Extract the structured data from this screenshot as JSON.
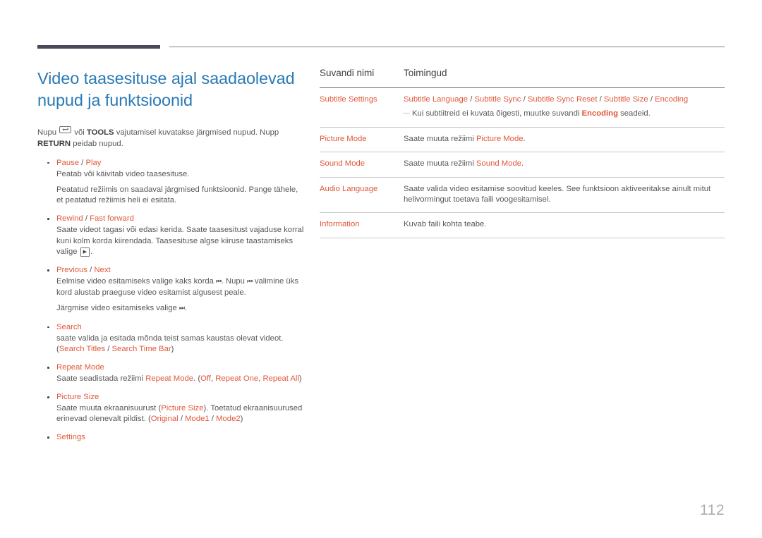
{
  "document": {
    "page_number": "112",
    "colors": {
      "heading_blue": "#2a7ab5",
      "accent_orange": "#e0583a",
      "body_gray": "#58585a",
      "rule_dark": "#4a4759",
      "note_gray": "#a9a8ac"
    }
  },
  "heading": {
    "title": "Video taasesituse ajal saadaolevad nupud ja funktsioonid"
  },
  "intro": {
    "before_key": "Nupu ",
    "key_icon": "enter-return-key-icon",
    "after_key": " või ",
    "tools_label": "TOOLS",
    "middle": " vajutamisel kuvatakse järgmised nupud. Nupp ",
    "return_label": "RETURN",
    "end": " peidab nupud."
  },
  "bullets": [
    {
      "title_parts": [
        {
          "text": "Pause",
          "style": "accent"
        },
        {
          "text": " / ",
          "style": "plain"
        },
        {
          "text": "Play",
          "style": "accent"
        }
      ],
      "paragraphs": [
        [
          {
            "text": "Peatab või käivitab video taasesituse.",
            "style": "plain"
          }
        ],
        [
          {
            "text": "Peatatud režiimis on saadaval järgmised funktsioonid. Pange tähele, et peatatud režiimis heli ei esitata.",
            "style": "plain"
          }
        ]
      ]
    },
    {
      "title_parts": [
        {
          "text": "Rewind",
          "style": "accent"
        },
        {
          "text": " / ",
          "style": "plain"
        },
        {
          "text": "Fast forward",
          "style": "accent"
        }
      ],
      "paragraphs": [
        [
          {
            "text": "Saate videot tagasi või edasi kerida. Saate taasesitust vajaduse korral kuni kolm korda kiirendada. Taasesituse algse kiiruse taastamiseks valige ",
            "style": "plain"
          },
          {
            "text": "▶",
            "style": "key"
          },
          {
            "text": ".",
            "style": "plain"
          }
        ]
      ]
    },
    {
      "title_parts": [
        {
          "text": "Previous",
          "style": "accent"
        },
        {
          "text": " / ",
          "style": "plain"
        },
        {
          "text": "Next",
          "style": "accent"
        }
      ],
      "paragraphs": [
        [
          {
            "text": "Eelmise video esitamiseks valige kaks korda ",
            "style": "plain"
          },
          {
            "text": "⏮",
            "style": "glyph"
          },
          {
            "text": ". Nupu ",
            "style": "plain"
          },
          {
            "text": "⏮",
            "style": "glyph"
          },
          {
            "text": " valimine üks kord alustab praeguse video esitamist algusest peale.",
            "style": "plain"
          }
        ],
        [
          {
            "text": "Järgmise video esitamiseks valige ",
            "style": "plain"
          },
          {
            "text": "⏭",
            "style": "glyph"
          },
          {
            "text": ".",
            "style": "plain"
          }
        ]
      ]
    },
    {
      "title_parts": [
        {
          "text": "Search",
          "style": "accent"
        }
      ],
      "paragraphs": [
        [
          {
            "text": "saate valida ja esitada mõnda teist samas kaustas olevat videot. (",
            "style": "plain"
          },
          {
            "text": "Search Titles",
            "style": "accent"
          },
          {
            "text": " / ",
            "style": "plain"
          },
          {
            "text": "Search Time Bar",
            "style": "accent"
          },
          {
            "text": ")",
            "style": "plain"
          }
        ]
      ]
    },
    {
      "title_parts": [
        {
          "text": "Repeat Mode",
          "style": "accent"
        }
      ],
      "paragraphs": [
        [
          {
            "text": "Saate seadistada režiimi ",
            "style": "plain"
          },
          {
            "text": "Repeat Mode",
            "style": "accent"
          },
          {
            "text": ". (",
            "style": "plain"
          },
          {
            "text": "Off",
            "style": "accent"
          },
          {
            "text": ", ",
            "style": "plain"
          },
          {
            "text": "Repeat One",
            "style": "accent"
          },
          {
            "text": ", ",
            "style": "plain"
          },
          {
            "text": "Repeat All",
            "style": "accent"
          },
          {
            "text": ")",
            "style": "plain"
          }
        ]
      ]
    },
    {
      "title_parts": [
        {
          "text": "Picture Size",
          "style": "accent"
        }
      ],
      "paragraphs": [
        [
          {
            "text": "Saate muuta ekraanisuurust (",
            "style": "plain"
          },
          {
            "text": "Picture Size",
            "style": "accent"
          },
          {
            "text": "). Toetatud ekraanisuurused erinevad olenevalt pildist. (",
            "style": "plain"
          },
          {
            "text": "Original",
            "style": "accent"
          },
          {
            "text": " / ",
            "style": "plain"
          },
          {
            "text": "Mode1",
            "style": "accent"
          },
          {
            "text": " / ",
            "style": "plain"
          },
          {
            "text": "Mode2",
            "style": "accent"
          },
          {
            "text": ")",
            "style": "plain"
          }
        ]
      ]
    },
    {
      "title_parts": [
        {
          "text": "Settings",
          "style": "accent"
        }
      ],
      "paragraphs": []
    }
  ],
  "table": {
    "columns": [
      "Suvandi nimi",
      "Toimingud"
    ],
    "rows": [
      {
        "name": "Subtitle Settings",
        "action_parts": [
          {
            "text": "Subtitle Language",
            "style": "accent"
          },
          {
            "text": " / ",
            "style": "plain"
          },
          {
            "text": "Subtitle Sync",
            "style": "accent"
          },
          {
            "text": " / ",
            "style": "plain"
          },
          {
            "text": "Subtitle Sync Reset",
            "style": "accent"
          },
          {
            "text": " / ",
            "style": "plain"
          },
          {
            "text": "Subtitle Size",
            "style": "accent"
          },
          {
            "text": " / ",
            "style": "plain"
          },
          {
            "text": "Encoding",
            "style": "accent"
          }
        ],
        "note_parts": [
          {
            "text": "Kui subtiitreid ei kuvata õigesti, muutke suvandi ",
            "style": "plain"
          },
          {
            "text": "Encoding",
            "style": "accent"
          },
          {
            "text": " seadeid.",
            "style": "plain"
          }
        ]
      },
      {
        "name": "Picture Mode",
        "action_parts": [
          {
            "text": "Saate muuta režiimi ",
            "style": "plain"
          },
          {
            "text": "Picture Mode",
            "style": "accent"
          },
          {
            "text": ".",
            "style": "plain"
          }
        ],
        "note_parts": []
      },
      {
        "name": "Sound Mode",
        "action_parts": [
          {
            "text": "Saate muuta režiimi ",
            "style": "plain"
          },
          {
            "text": "Sound Mode",
            "style": "accent"
          },
          {
            "text": ".",
            "style": "plain"
          }
        ],
        "note_parts": []
      },
      {
        "name": "Audio Language",
        "action_parts": [
          {
            "text": "Saate valida video esitamise soovitud keeles. See funktsioon aktiveeritakse ainult mitut helivormingut toetava faili voogesitamisel.",
            "style": "plain"
          }
        ],
        "note_parts": []
      },
      {
        "name": "Information",
        "action_parts": [
          {
            "text": "Kuvab faili kohta teabe.",
            "style": "plain"
          }
        ],
        "note_parts": []
      }
    ]
  }
}
